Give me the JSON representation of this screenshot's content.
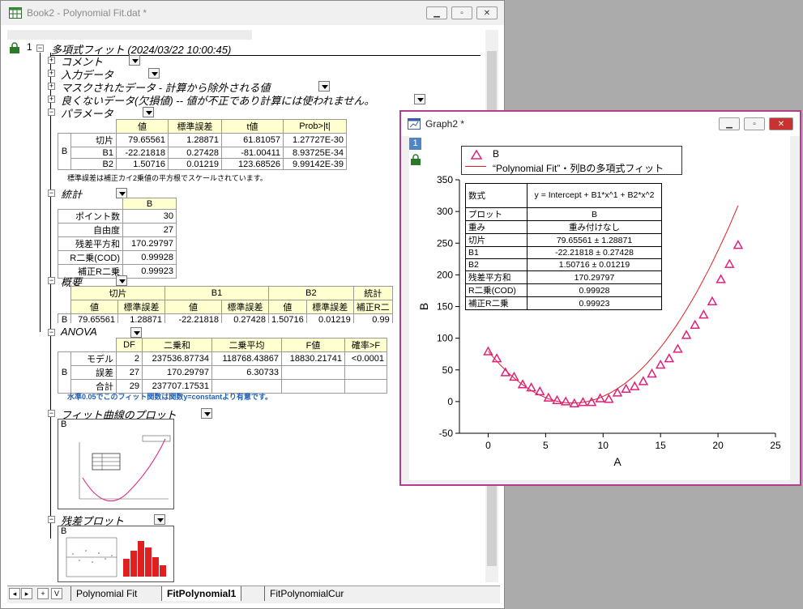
{
  "book": {
    "title": "Book2 - Polynomial Fit.dat *",
    "row_number": "1",
    "root_label": "多項式フィット (2024/03/22 10:00:45)",
    "sections": {
      "comment": "コメント",
      "input": "入力データ",
      "masked": "マスクされたデータ - 計算から除外される値",
      "bad": "良くないデータ(欠損値) -- 値が不正であり計算には使われません。",
      "params": "パラメータ",
      "stats": "統計",
      "summary": "概要",
      "anova": "ANOVA",
      "fitplot": "フィット曲線のプロット",
      "resplot": "残差プロット"
    },
    "params_table": {
      "headers": [
        "値",
        "標準誤差",
        "t値",
        "Prob>|t|"
      ],
      "group": "B",
      "rows": [
        {
          "name": "切片",
          "cells": [
            "79.65561",
            "1.28871",
            "61.81057",
            "1.27727E-30"
          ]
        },
        {
          "name": "B1",
          "cells": [
            "-22.21818",
            "0.27428",
            "-81.00411",
            "8.93725E-34"
          ]
        },
        {
          "name": "B2",
          "cells": [
            "1.50716",
            "0.01219",
            "123.68526",
            "9.99142E-39"
          ]
        }
      ]
    },
    "params_note": "標準誤差は補正カイ2乗値の平方根でスケールされています。",
    "stats_table": {
      "col": "B",
      "rows": [
        {
          "name": "ポイント数",
          "value": "30"
        },
        {
          "name": "自由度",
          "value": "27"
        },
        {
          "name": "残差平方和",
          "value": "170.29797"
        },
        {
          "name": "R二乗(COD)",
          "value": "0.99928"
        },
        {
          "name": "補正R二乗",
          "value": "0.99923"
        }
      ]
    },
    "summary_table": {
      "groups": [
        "切片",
        "B1",
        "B2",
        "統計"
      ],
      "subheaders": [
        "値",
        "標準誤差",
        "値",
        "標準誤差",
        "値",
        "標準誤差",
        "補正R二"
      ],
      "row_label": "B",
      "cells": [
        "79.65561",
        "1.28871",
        "-22.21818",
        "0.27428",
        "1.50716",
        "0.01219",
        "0.99"
      ]
    },
    "anova_table": {
      "headers": [
        "DF",
        "二乗和",
        "二乗平均",
        "F値",
        "確率>F"
      ],
      "group": "B",
      "rows": [
        {
          "name": "モデル",
          "cells": [
            "2",
            "237536.87734",
            "118768.43867",
            "18830.21741",
            "<0.0001"
          ]
        },
        {
          "name": "誤差",
          "cells": [
            "27",
            "170.29797",
            "6.30733",
            "",
            ""
          ]
        },
        {
          "name": "合計",
          "cells": [
            "29",
            "237707.17531",
            "",
            "",
            ""
          ]
        }
      ]
    },
    "anova_note": "水準0.05でこのフィット関数は関数y=constantより有意です。",
    "thumb_label": "B",
    "tabs": [
      "Polynomial Fit",
      "FitPolynomial1",
      "FitPolynomialCur"
    ],
    "nav": [
      "◂",
      "▸",
      "+",
      "V"
    ]
  },
  "graph": {
    "title": "Graph2 *",
    "layer": "1",
    "legend": {
      "series": "B",
      "fit": "“Polynomial Fit”・列Bの多項式フィット"
    },
    "table_rows": [
      {
        "k": "数式",
        "v": "y = Intercept + B1*x^1 + B2*x^2"
      },
      {
        "k": "プロット",
        "v": "B"
      },
      {
        "k": "重み",
        "v": "重み付けなし"
      },
      {
        "k": "切片",
        "v": "79.65561 ± 1.28871"
      },
      {
        "k": "B1",
        "v": "-22.21818 ± 0.27428"
      },
      {
        "k": "B2",
        "v": "1.50716 ± 0.01219"
      },
      {
        "k": "残差平方和",
        "v": "170.29797"
      },
      {
        "k": "R二乗(COD)",
        "v": "0.99928"
      },
      {
        "k": "補正R二乗",
        "v": "0.99923"
      }
    ]
  },
  "chart_data": {
    "type": "scatter",
    "xlabel": "A",
    "ylabel": "B",
    "xlim": [
      -2.5,
      25
    ],
    "ylim": [
      -50,
      350
    ],
    "xticks": [
      0,
      5,
      10,
      15,
      20,
      25
    ],
    "yticks": [
      -50,
      0,
      50,
      100,
      150,
      200,
      250,
      300,
      350
    ],
    "x": [
      0,
      0.75,
      1.5,
      2.25,
      3,
      3.75,
      4.5,
      5.25,
      6,
      6.75,
      7.5,
      8.25,
      9,
      9.75,
      10.5,
      11.25,
      12,
      12.75,
      13.5,
      14.25,
      15,
      15.75,
      16.5,
      17.25,
      18,
      18.75,
      19.5,
      20.25,
      21,
      21.75
    ],
    "y": [
      79,
      68,
      46,
      39,
      27,
      22,
      16,
      6,
      2,
      0,
      -3,
      -1,
      -1,
      5,
      4,
      14,
      20,
      24,
      32,
      44,
      58,
      68,
      83,
      105,
      121,
      137,
      158,
      193,
      217,
      247
    ],
    "fit": {
      "intercept": 79.65561,
      "b1": -22.21818,
      "b2": 1.50716
    },
    "colors": {
      "marker": "#e0217b",
      "fit": "#e02020"
    }
  }
}
